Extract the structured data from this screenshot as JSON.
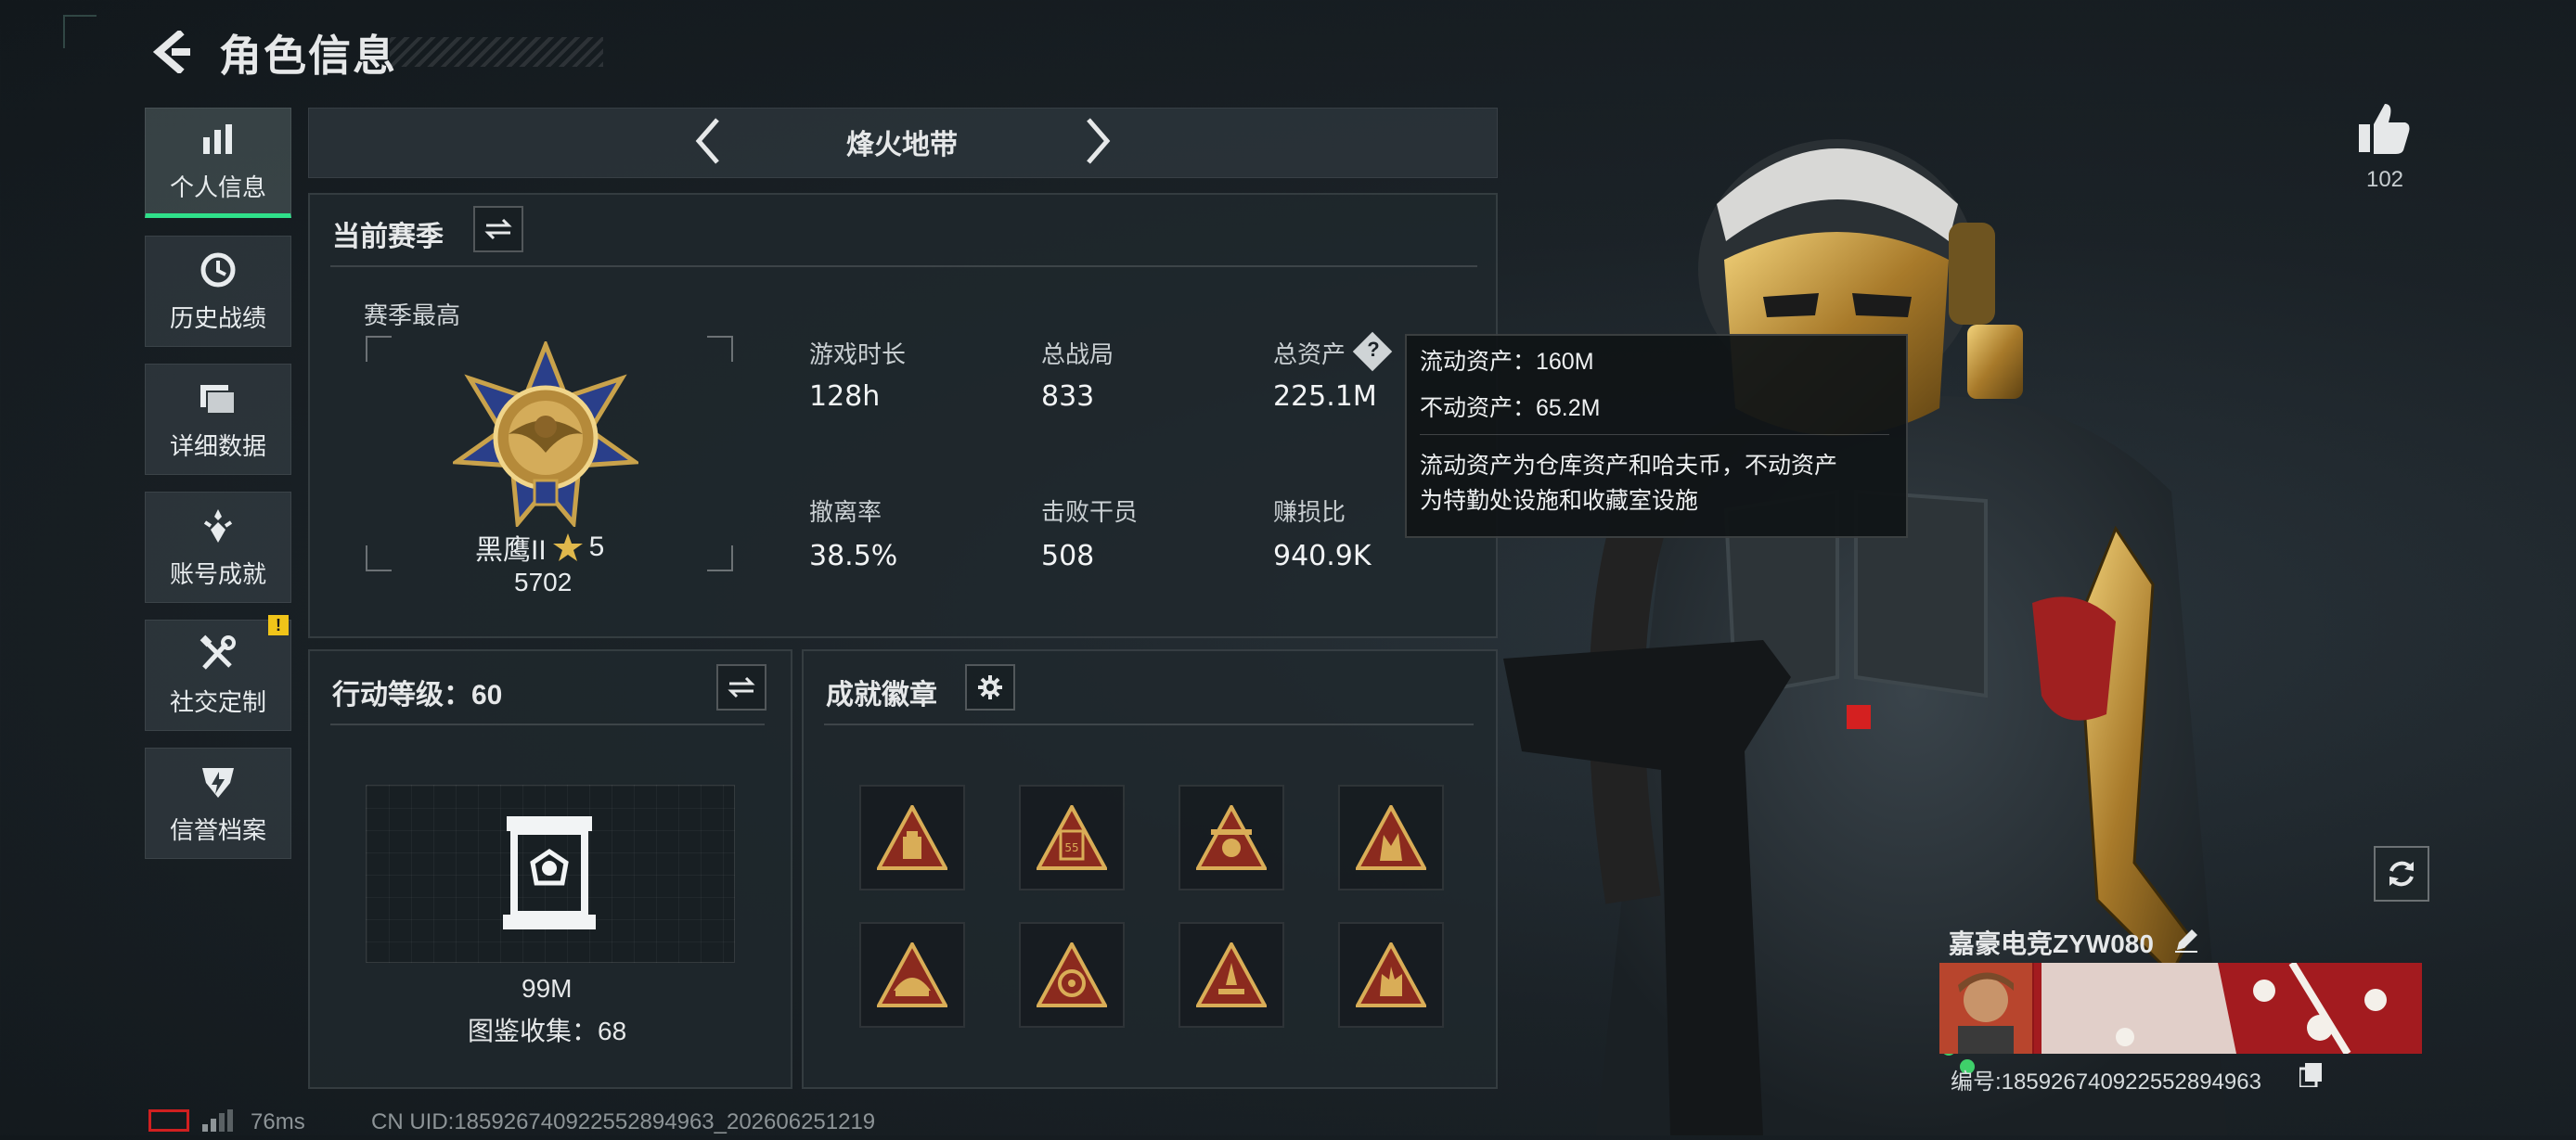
{
  "header": {
    "title": "角色信息"
  },
  "sidebar": {
    "items": [
      {
        "label": "个人信息",
        "icon": "bar-chart-icon",
        "active": true
      },
      {
        "label": "历史战绩",
        "icon": "clock-icon"
      },
      {
        "label": "详细数据",
        "icon": "folder-icon"
      },
      {
        "label": "账号成就",
        "icon": "medal-icon"
      },
      {
        "label": "社交定制",
        "icon": "tools-icon",
        "alert": "!"
      },
      {
        "label": "信誉档案",
        "icon": "shield-bolt-icon"
      }
    ]
  },
  "mode": {
    "title": "烽火地带"
  },
  "season": {
    "header": "当前赛季",
    "peak_label": "赛季最高",
    "rank_name": "黑鹰II",
    "rank_stars": "5",
    "rank_score": "5702",
    "stats": [
      {
        "label": "游戏时长",
        "value": "128h"
      },
      {
        "label": "总战局",
        "value": "833"
      },
      {
        "label": "总资产",
        "value": "225.1M"
      },
      {
        "label": "撤离率",
        "value": "38.5%"
      },
      {
        "label": "击败干员",
        "value": "508"
      },
      {
        "label": "赚损比",
        "value": "940.9K"
      }
    ]
  },
  "tooltip": {
    "liquid": "流动资产：160M",
    "fixed": "不动资产：65.2M",
    "desc_line1": "流动资产为仓库资产和哈夫币，不动资产",
    "desc_line2": "为特勤处设施和收藏室设施"
  },
  "action_level": {
    "header": "行动等级：60",
    "value": "99M",
    "collection": "图鉴收集：68"
  },
  "achievements": {
    "header": "成就徽章",
    "badges": [
      "badge-1",
      "badge-2",
      "badge-3",
      "badge-4",
      "badge-5",
      "badge-6",
      "badge-7",
      "badge-8"
    ]
  },
  "player": {
    "likes": "102",
    "name": "嘉豪电竞ZYW080",
    "id": "编号:1859267409225528949​63"
  },
  "status": {
    "ping": "76ms",
    "uid": "CN UID:1859267409225528949​63_202606251219"
  },
  "colors": {
    "accent": "#2fe08a",
    "alert": "#f0c419",
    "card_red": "#8e1518"
  }
}
